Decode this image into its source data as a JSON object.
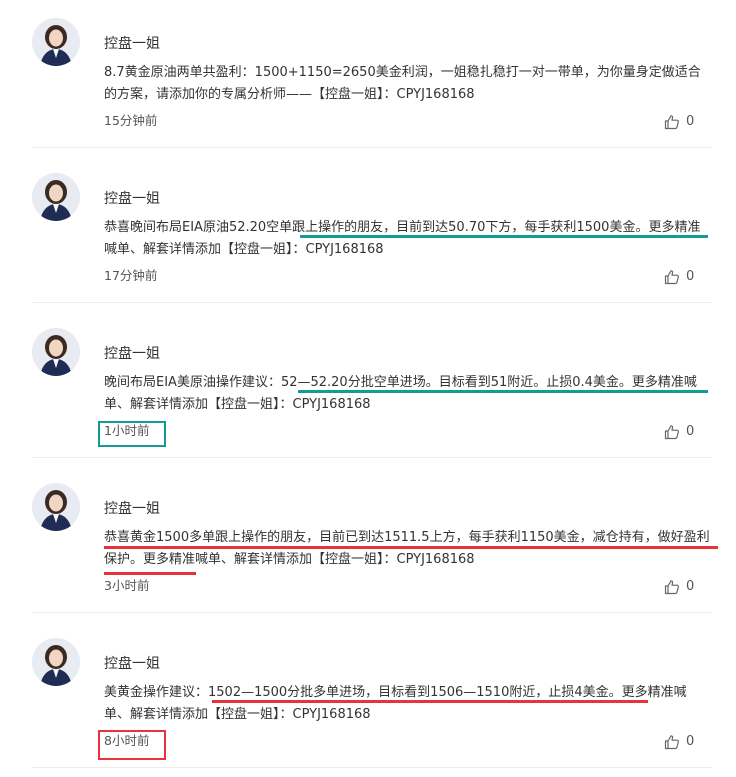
{
  "feed": {
    "posts": [
      {
        "author": "控盘一姐",
        "text": "8.7黄金原油两单共盈利：1500+1150=2650美金利润，一姐稳扎稳打一对一带单，为你量身定做适合的方案，请添加你的专属分析师——【控盘一姐】：CPYJ168168",
        "time": "15分钟前",
        "likes": "0"
      },
      {
        "author": "控盘一姐",
        "text": "恭喜晚间布局EIA原油52.20空单跟上操作的朋友，目前到达50.70下方，每手获利1500美金。更多精准喊单、解套详情添加【控盘一姐】：CPYJ168168",
        "time": "17分钟前",
        "likes": "0"
      },
      {
        "author": "控盘一姐",
        "text": "晚间布局EIA美原油操作建议：52—52.20分批空单进场。目标看到51附近。止损0.4美金。更多精准喊单、解套详情添加【控盘一姐】：CPYJ168168",
        "time": "1小时前",
        "likes": "0"
      },
      {
        "author": "控盘一姐",
        "text": "恭喜黄金1500多单跟上操作的朋友，目前已到达1511.5上方，每手获利1150美金，减仓持有，做好盈利保护。更多精准喊单、解套详情添加【控盘一姐】：CPYJ168168",
        "time": "3小时前",
        "likes": "0"
      },
      {
        "author": "控盘一姐",
        "text": "美黄金操作建议：1502—1500分批多单进场，目标看到1506—1510附近，止损4美金。更多精准喊单、解套详情添加【控盘一姐】：CPYJ168168",
        "time": "8小时前",
        "likes": "0"
      }
    ]
  },
  "icons": {
    "like": "thumbs-up-icon",
    "avatar": "profile-photo"
  },
  "colors": {
    "annotation_teal": "#149b96",
    "annotation_red": "#e8333c",
    "divider": "#ececec"
  }
}
